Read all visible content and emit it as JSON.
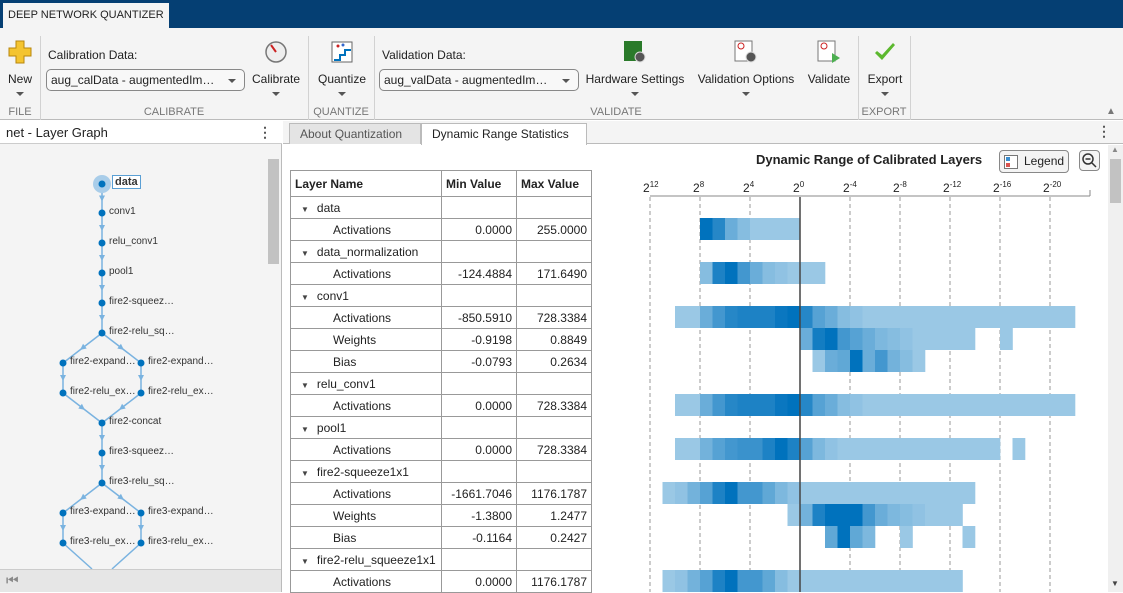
{
  "app": {
    "tab": "DEEP NETWORK QUANTIZER"
  },
  "ribbon": {
    "new": "New",
    "file_group": "FILE",
    "calibration_label": "Calibration Data:",
    "calibration_value": "aug_calData - augmentedIm…",
    "calibrate": "Calibrate",
    "calibrate_group": "CALIBRATE",
    "quantize": "Quantize",
    "quantize_group": "QUANTIZE",
    "validation_label": "Validation Data:",
    "validation_value": "aug_valData - augmentedIm…",
    "hardware": "Hardware Settings",
    "validation_options": "Validation Options",
    "validate": "Validate",
    "validate_group": "VALIDATE",
    "export": "Export",
    "export_group": "EXPORT"
  },
  "left_panel": {
    "title": "net - Layer Graph",
    "nodes": [
      "data",
      "conv1",
      "relu_conv1",
      "pool1",
      "fire2-squeez…",
      "fire2-relu_sq…",
      "fire2-expand…",
      "fire2-expand…",
      "fire2-relu_ex…",
      "fire2-relu_ex…",
      "fire2-concat",
      "fire3-squeez…",
      "fire3-relu_sq…",
      "fire3-expand…",
      "fire3-expand…",
      "fire3-relu_ex…",
      "fire3-relu_ex…"
    ]
  },
  "tabs": [
    "About Quantization",
    "Dynamic Range Statistics"
  ],
  "table": {
    "headers": [
      "Layer Name",
      "Min Value",
      "Max Value"
    ],
    "rows": [
      {
        "name": "data",
        "group": true
      },
      {
        "name": "Activations",
        "min": "0.0000",
        "max": "255.0000"
      },
      {
        "name": "data_normalization",
        "group": true
      },
      {
        "name": "Activations",
        "min": "-124.4884",
        "max": "171.6490"
      },
      {
        "name": "conv1",
        "group": true
      },
      {
        "name": "Activations",
        "min": "-850.5910",
        "max": "728.3384"
      },
      {
        "name": "Weights",
        "min": "-0.9198",
        "max": "0.8849"
      },
      {
        "name": "Bias",
        "min": "-0.0793",
        "max": "0.2634"
      },
      {
        "name": "relu_conv1",
        "group": true
      },
      {
        "name": "Activations",
        "min": "0.0000",
        "max": "728.3384"
      },
      {
        "name": "pool1",
        "group": true
      },
      {
        "name": "Activations",
        "min": "0.0000",
        "max": "728.3384"
      },
      {
        "name": "fire2-squeeze1x1",
        "group": true
      },
      {
        "name": "Activations",
        "min": "-1661.7046",
        "max": "1176.1787"
      },
      {
        "name": "Weights",
        "min": "-1.3800",
        "max": "1.2477"
      },
      {
        "name": "Bias",
        "min": "-0.1164",
        "max": "0.2427"
      },
      {
        "name": "fire2-relu_squeeze1x1",
        "group": true
      },
      {
        "name": "Activations",
        "min": "0.0000",
        "max": "1176.1787"
      }
    ]
  },
  "chart_data": {
    "type": "heatmap",
    "title": "Dynamic Range of Calibrated Layers",
    "legend_button": "Legend",
    "x_ticks": [
      {
        "base": "2",
        "exp": "12"
      },
      {
        "base": "2",
        "exp": "8"
      },
      {
        "base": "2",
        "exp": "4"
      },
      {
        "base": "2",
        "exp": "0"
      },
      {
        "base": "2",
        "exp": "-4"
      },
      {
        "base": "2",
        "exp": "-8"
      },
      {
        "base": "2",
        "exp": "-12"
      },
      {
        "base": "2",
        "exp": "-16"
      },
      {
        "base": "2",
        "exp": "-20"
      }
    ],
    "colors": {
      "low": "#c0ddef",
      "high": "#0072bd"
    },
    "rows": [
      {
        "table_row": 1,
        "start_exp": 8,
        "counts": [
          1,
          0.8,
          0.45,
          0.3,
          0.2,
          0.2,
          0.2,
          0.2
        ]
      },
      {
        "table_row": 3,
        "start_exp": 8,
        "counts": [
          0.3,
          0.85,
          1,
          0.65,
          0.45,
          0.3,
          0.25,
          0.2,
          0.2,
          0.2
        ]
      },
      {
        "table_row": 5,
        "start_exp": 10,
        "counts": [
          0.2,
          0.2,
          0.45,
          0.65,
          0.8,
          0.85,
          0.85,
          0.85,
          0.95,
          1,
          0.8,
          0.55,
          0.45,
          0.3,
          0.25,
          0.2,
          0.2,
          0.2,
          0.2,
          0.2,
          0.2,
          0.2,
          0.2,
          0.2,
          0.2,
          0.2,
          0.2,
          0.2,
          0.2,
          0.2,
          0.2,
          0.2
        ]
      },
      {
        "table_row": 6,
        "start_exp": 0,
        "counts": [
          0.45,
          0.9,
          1,
          0.65,
          0.55,
          0.45,
          0.35,
          0.3,
          0.25,
          0.2,
          0.2,
          0.2,
          0.2,
          0.2,
          null,
          null,
          0.2
        ]
      },
      {
        "table_row": 7,
        "start_exp": -1,
        "counts": [
          0.2,
          0.45,
          0.5,
          1,
          0.45,
          0.65,
          0.4,
          0.3,
          0.2
        ]
      },
      {
        "table_row": 9,
        "start_exp": 10,
        "counts": [
          0.2,
          0.2,
          0.45,
          0.65,
          0.8,
          0.85,
          0.85,
          0.85,
          0.95,
          1,
          0.8,
          0.55,
          0.45,
          0.3,
          0.25,
          0.2,
          0.2,
          0.2,
          0.2,
          0.2,
          0.2,
          0.2,
          0.2,
          0.2,
          0.2,
          0.2,
          0.2,
          0.2,
          0.2,
          0.2,
          0.2,
          0.2
        ]
      },
      {
        "table_row": 11,
        "start_exp": 10,
        "counts": [
          0.2,
          0.2,
          0.4,
          0.55,
          0.65,
          0.7,
          0.7,
          0.85,
          1,
          0.85,
          0.55,
          0.35,
          0.25,
          0.2,
          0.2,
          0.2,
          0.2,
          0.2,
          0.2,
          0.2,
          0.2,
          0.2,
          0.2,
          0.2,
          0.2,
          0.2,
          null,
          0.2
        ]
      },
      {
        "table_row": 13,
        "start_exp": 11,
        "counts": [
          0.2,
          0.25,
          0.4,
          0.55,
          0.85,
          1,
          0.65,
          0.65,
          0.5,
          0.35,
          0.25,
          0.2,
          0.2,
          0.2,
          0.2,
          0.2,
          0.2,
          0.2,
          0.2,
          0.2,
          0.2,
          0.2,
          0.2,
          0.2,
          0.2
        ]
      },
      {
        "table_row": 14,
        "start_exp": 1,
        "counts": [
          0.2,
          0.4,
          0.85,
          1,
          1,
          1,
          0.65,
          0.45,
          0.35,
          0.3,
          0.25,
          0.2,
          0.2,
          0.2
        ]
      },
      {
        "table_row": 15,
        "start_exp": -2,
        "counts": [
          0.5,
          1,
          0.5,
          0.35,
          null,
          null,
          0.2,
          null,
          null,
          null,
          null,
          0.2
        ]
      },
      {
        "table_row": 17,
        "start_exp": 11,
        "counts": [
          0.2,
          0.25,
          0.4,
          0.55,
          0.85,
          1,
          0.65,
          0.65,
          0.5,
          0.3,
          0.2,
          0.2,
          0.2,
          0.2,
          0.2,
          0.2,
          0.2,
          0.2,
          0.2,
          0.2,
          0.2,
          0.2,
          0.2,
          0.2
        ]
      }
    ]
  }
}
